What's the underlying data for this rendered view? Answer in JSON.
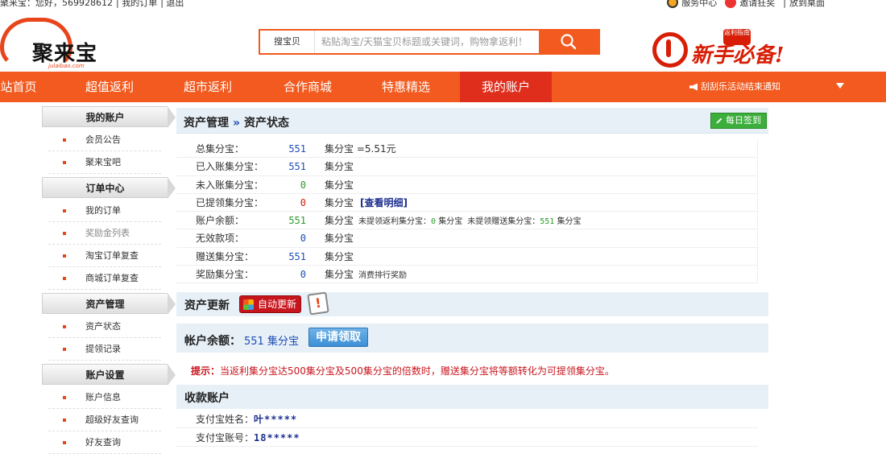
{
  "topbar": {
    "greeting": "聚来宝：您好，569928612",
    "my_orders": "我的订单",
    "logout": "退出",
    "service_center": "服务中心",
    "invite": "邀请狂奖",
    "desktop": "放到桌面"
  },
  "logo": {
    "name": "聚来宝",
    "domain": "julaibao.com"
  },
  "search": {
    "category": "搜宝贝",
    "placeholder": "粘贴淘宝/天猫宝贝标题或关键词，购物拿返利！",
    "button_icon": "search-icon"
  },
  "promo": {
    "text": "新手必备!",
    "tag": "返利指南"
  },
  "nav": {
    "items": [
      {
        "label": "站首页"
      },
      {
        "label": "超值返利"
      },
      {
        "label": "超市返利"
      },
      {
        "label": "合作商城"
      },
      {
        "label": "特惠精选"
      },
      {
        "label": "我的账户"
      }
    ],
    "active_index": 5,
    "notice": "刮刮乐活动结束通知"
  },
  "sidebar": {
    "groups": [
      {
        "title": "我的账户",
        "items": [
          "会员公告",
          "聚来宝吧"
        ]
      },
      {
        "title": "订单中心",
        "items": [
          "我的订单",
          "奖励金列表",
          "淘宝订单复查",
          "商城订单复查"
        ]
      },
      {
        "title": "资产管理",
        "items": [
          "资产状态",
          "提领记录"
        ]
      },
      {
        "title": "账户设置",
        "items": [
          "账户信息",
          "超级好友查询",
          "好友查询"
        ]
      }
    ]
  },
  "main": {
    "breadcrumb": {
      "parent": "资产管理",
      "sep": "»",
      "current": "资产状态"
    },
    "sign_button": "每日签到",
    "assets": [
      {
        "label": "总集分宝：",
        "value": "551",
        "unit": "集分宝 =5.51元"
      },
      {
        "label": "已入账集分宝：",
        "value": "551",
        "unit": "集分宝"
      },
      {
        "label": "未入账集分宝：",
        "value": "0",
        "unit": "集分宝"
      },
      {
        "label": "已提领集分宝：",
        "value": "0",
        "unit": "集分宝",
        "link": "[查看明细]"
      },
      {
        "label": "账户余额：",
        "value": "551",
        "unit": "集分宝",
        "extra1": "未提领返利集分宝：",
        "extra1_val": "0",
        "extra1_unit": "集分宝",
        "extra2": "未提领赠送集分宝：",
        "extra2_val": "551",
        "extra2_unit": "集分宝"
      },
      {
        "label": "无效款项：",
        "value": "0",
        "unit": "集分宝"
      },
      {
        "label": "赠送集分宝：",
        "value": "551",
        "unit": "集分宝"
      },
      {
        "label": "奖励集分宝：",
        "value": "0",
        "unit": "集分宝",
        "note": "消费排行奖励"
      }
    ],
    "update_title": "资产更新",
    "auto_update": "自动更新",
    "balance_label": "帐户余额：",
    "balance_value": "551 集分宝",
    "apply_button": "申请领取",
    "tip_label": "提示：",
    "tip_text": "当返利集分宝达500集分宝及500集分宝的倍数时，赠送集分宝将等额转化为可提领集分宝。",
    "account_title": "收款账户",
    "alipay_name_label": "支付宝姓名：",
    "alipay_name": "叶*****",
    "alipay_account_label": "支付宝账号：",
    "alipay_account": "18*****"
  }
}
